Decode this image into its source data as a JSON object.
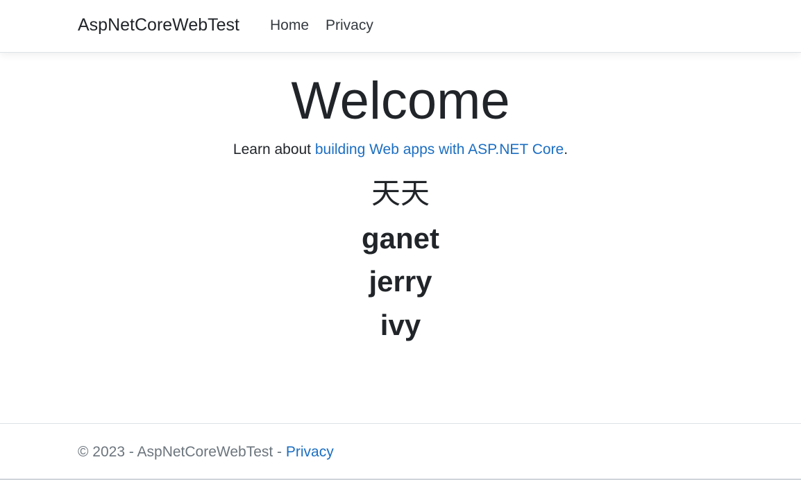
{
  "navbar": {
    "brand": "AspNetCoreWebTest",
    "links": [
      {
        "label": "Home"
      },
      {
        "label": "Privacy"
      }
    ]
  },
  "main": {
    "heading": "Welcome",
    "learn_prefix": "Learn about ",
    "learn_link": "building Web apps with ASP.NET Core",
    "learn_suffix": ".",
    "names": [
      "天天",
      "ganet",
      "jerry",
      "ivy"
    ]
  },
  "footer": {
    "copyright": "© 2023 - AspNetCoreWebTest - ",
    "privacy_link": "Privacy"
  },
  "colors": {
    "link": "#1b6ec2",
    "text": "#212529",
    "muted": "#6c757d",
    "border": "#dee2e6"
  }
}
